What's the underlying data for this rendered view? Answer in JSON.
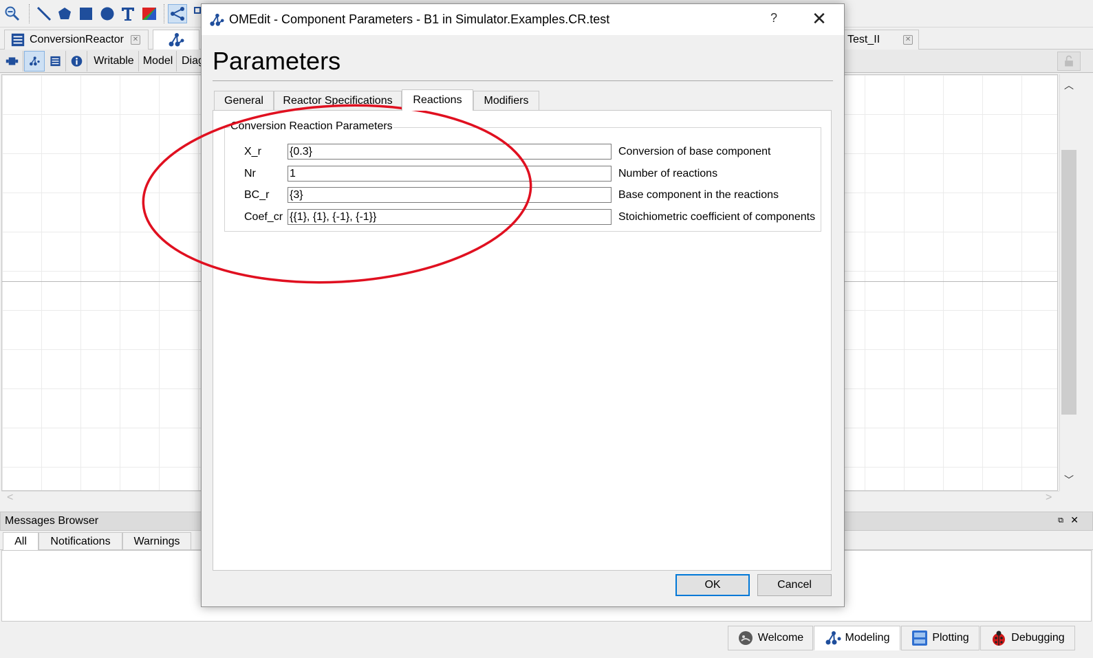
{
  "main_window": {
    "doc_tabs": {
      "first_tab_label": "ConversionReactor",
      "right_tab_label": "Test_II"
    },
    "view_toolbar": {
      "writable_label": "Writable",
      "model_label": "Model",
      "diagram_label": "Diag"
    },
    "messages": {
      "title": "Messages Browser",
      "float_glyph": "⧉",
      "close_glyph": "✕",
      "tabs": [
        "All",
        "Notifications",
        "Warnings"
      ]
    },
    "perspectives": [
      "Welcome",
      "Modeling",
      "Plotting",
      "Debugging"
    ],
    "scroll_arrows": {
      "up": "︿",
      "down": "﹀",
      "left": "<",
      "right": ">"
    }
  },
  "dialog": {
    "title": "OMEdit - Component Parameters - B1 in Simulator.Examples.CR.test",
    "help_glyph": "?",
    "close_glyph": "✕",
    "heading": "Parameters",
    "tabs": [
      "General",
      "Reactor Specifications",
      "Reactions",
      "Modifiers"
    ],
    "active_tab": "Reactions",
    "group_title": "Conversion Reaction Parameters",
    "params": [
      {
        "name": "X_r",
        "value": "{0.3}",
        "description": "Conversion of base component"
      },
      {
        "name": "Nr",
        "value": "1",
        "description": "Number of reactions"
      },
      {
        "name": "BC_r",
        "value": "{3}",
        "description": "Base component in the reactions"
      },
      {
        "name": "Coef_cr",
        "value": "{{1}, {1}, {-1}, {-1}}",
        "description": "Stoichiometric coefficient of components"
      }
    ],
    "ok_label": "OK",
    "cancel_label": "Cancel"
  },
  "colors": {
    "annotation_ellipse": "#e01020",
    "default_button_border": "#0078d7",
    "active_toggle_bg": "#cde0f4"
  }
}
